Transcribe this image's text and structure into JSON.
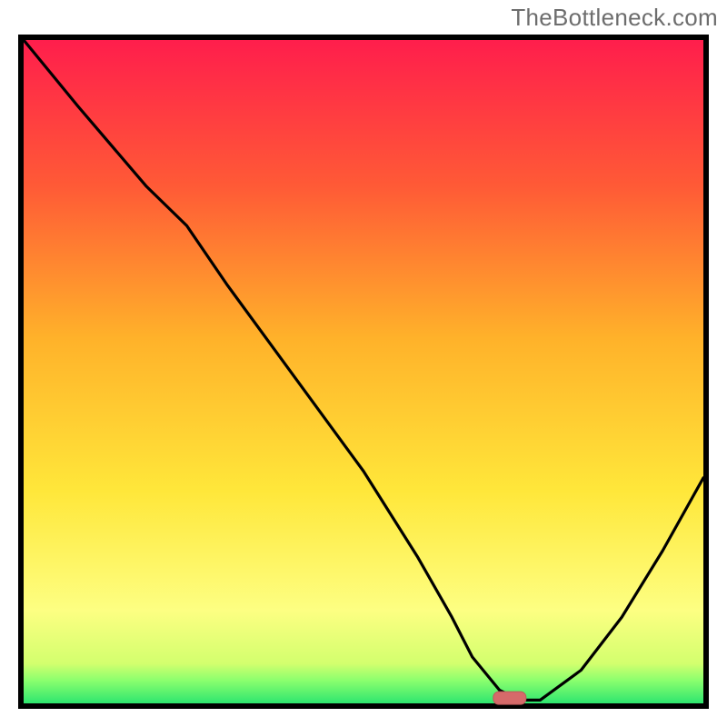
{
  "watermark": "TheBottleneck.com",
  "colors": {
    "gradient_top": "#ff1e4c",
    "gradient_mid1": "#ff6a2a",
    "gradient_mid2": "#ffd42a",
    "gradient_mid3": "#fffd70",
    "gradient_bottom": "#2ee66f",
    "border": "#000000",
    "curve": "#000000",
    "marker_fill": "#d66a6a",
    "marker_stroke": "#bd5a5a"
  },
  "chart_data": {
    "type": "line",
    "title": "",
    "xlabel": "",
    "ylabel": "",
    "xlim": [
      0,
      100
    ],
    "ylim": [
      0,
      100
    ],
    "grid": false,
    "series": [
      {
        "name": "bottleneck-curve",
        "x": [
          0,
          8,
          18,
          24,
          30,
          40,
          50,
          58,
          63,
          66,
          70,
          73,
          76,
          82,
          88,
          94,
          100
        ],
        "y": [
          100,
          90,
          78,
          72,
          63,
          49,
          35,
          22,
          13,
          7,
          2,
          0.5,
          0.5,
          5,
          13,
          23,
          34
        ]
      }
    ],
    "marker": {
      "x": 71.5,
      "y": 0.8,
      "label": "optimal-point"
    },
    "gradient_stops": [
      {
        "offset": 0.0,
        "color": "#ff1e4c"
      },
      {
        "offset": 0.22,
        "color": "#ff5a36"
      },
      {
        "offset": 0.45,
        "color": "#ffb22a"
      },
      {
        "offset": 0.68,
        "color": "#ffe73a"
      },
      {
        "offset": 0.86,
        "color": "#fdff82"
      },
      {
        "offset": 0.94,
        "color": "#d3ff6e"
      },
      {
        "offset": 0.965,
        "color": "#8cff6e"
      },
      {
        "offset": 1.0,
        "color": "#2ee66f"
      }
    ]
  }
}
